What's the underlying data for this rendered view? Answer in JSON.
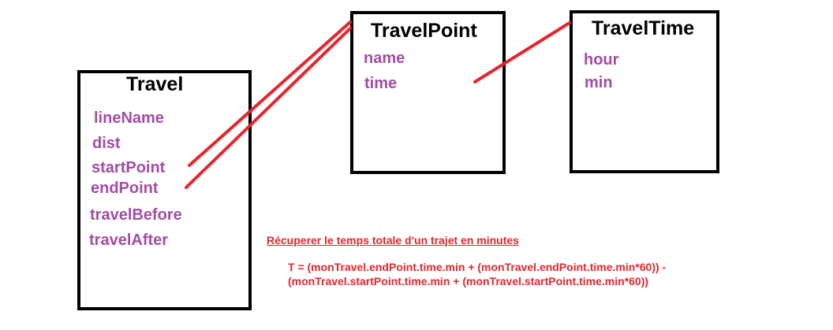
{
  "colors": {
    "box_border": "#000000",
    "title": "#000000",
    "attribute": "#a24ca6",
    "connector": "#e8242c",
    "note": "#e8242c"
  },
  "classes": {
    "travel": {
      "title": "Travel",
      "attributes": [
        "lineName",
        "dist",
        "startPoint",
        "endPoint",
        "travelBefore",
        "travelAfter"
      ]
    },
    "travel_point": {
      "title": "TravelPoint",
      "attributes": [
        "name",
        "time"
      ]
    },
    "travel_time": {
      "title": "TravelTime",
      "attributes": [
        "hour",
        "min"
      ]
    }
  },
  "note": {
    "heading": "Récuperer le temps totale d'un trajet en minutes",
    "formula_line1": "T = (monTravel.endPoint.time.min + (monTravel.endPoint.time.min*60)) -",
    "formula_line2": "(monTravel.startPoint.time.min + (monTravel.startPoint.time.min*60))"
  }
}
